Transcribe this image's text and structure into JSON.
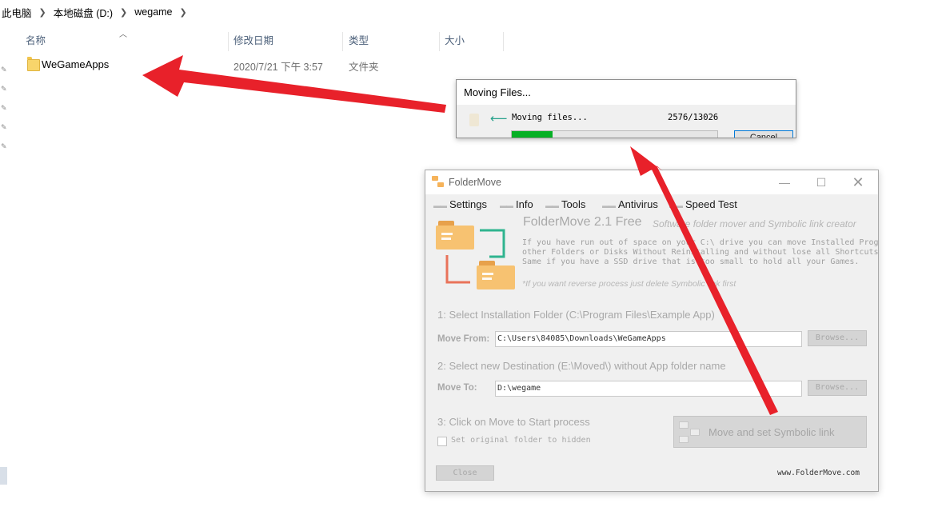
{
  "explorer": {
    "breadcrumb": [
      "此电脑",
      "本地磁盘 (D:)",
      "wegame"
    ],
    "columns": {
      "name": "名称",
      "date": "修改日期",
      "type": "类型",
      "size": "大小"
    },
    "files": [
      {
        "name": "WeGameApps",
        "date": "2020/7/21 下午 3:57",
        "type": "文件夹",
        "icon": "folder-icon"
      }
    ]
  },
  "moving_dialog": {
    "title": "Moving Files...",
    "status": "Moving files...",
    "count": "2576/13026",
    "progress_fraction": 0.198,
    "progress_color": "#06b025",
    "cancel_label": "Cancel"
  },
  "foldermove": {
    "title": "FolderMove",
    "menu": [
      "Settings",
      "Info",
      "Tools",
      "Antivirus",
      "Speed Test"
    ],
    "heading": "FolderMove 2.1 Free",
    "subheading": "Software folder mover and Symbolic link creator",
    "description": [
      "If you have run out of space on your C:\\ drive you can move Installed Prog",
      "other Folders or Disks Without Reinstalling and without lose all Shortcuts",
      "Same if you have a SSD drive that is too small to hold all your Games."
    ],
    "note": "*If you want reverse process just delete Symbolic link first",
    "step1": "1: Select Installation Folder (C:\\Program Files\\Example App)",
    "move_from_label": "Move From:",
    "move_from_value": "C:\\Users\\84085\\Downloads\\WeGameApps",
    "browse_label": "Browse...",
    "step2": "2: Select new Destination (E:\\Moved\\) without App folder name",
    "move_to_label": "Move To:",
    "move_to_value": "D:\\wegame",
    "step3": "3: Click on Move to Start process",
    "checkbox_label": "Set original folder to hidden",
    "checkbox_checked": false,
    "action_label": "Move and set Symbolic link",
    "close_label": "Close",
    "url": "www.FolderMove.com"
  },
  "annotations": {
    "arrow_color": "#e8212a"
  }
}
